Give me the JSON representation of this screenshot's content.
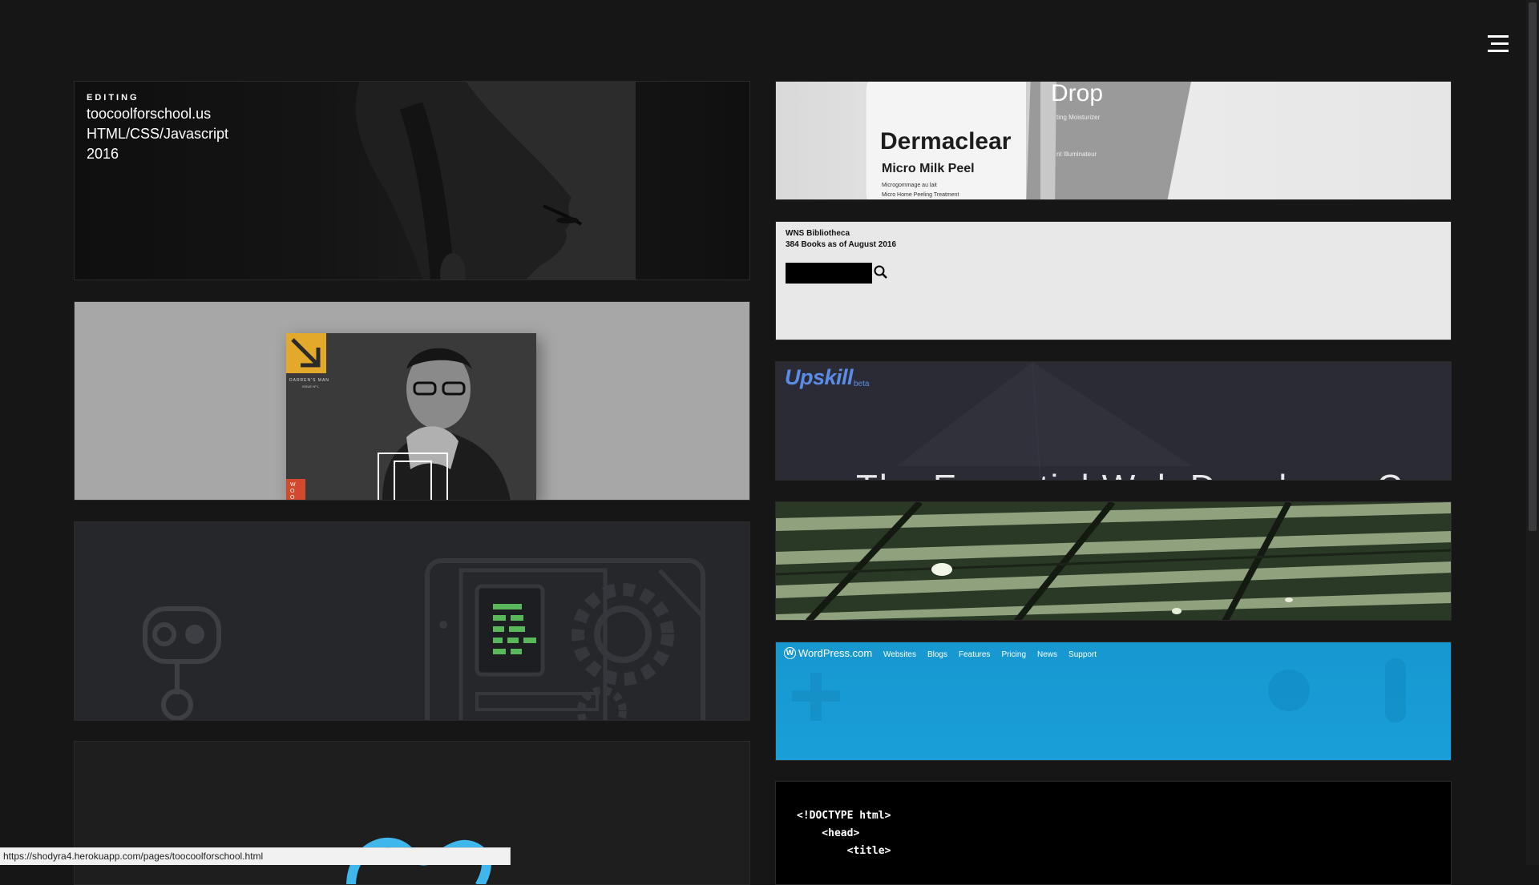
{
  "header": {
    "menu_icon": "hamburger-icon"
  },
  "portfolio": {
    "featured": {
      "category": "EDITING",
      "site": "toocoolforschool.us",
      "tech": "HTML/CSS/Javascript",
      "year": "2016"
    },
    "dermaclear": {
      "brand": "Dermaclear",
      "product": "Micro Milk Peel",
      "fine1": "Microgommage au lait",
      "fine2": "Micro Home Peeling Treatment",
      "brand2": "Drop",
      "sub1": "ting Moisturizer",
      "sub2": "nt Illuminateur"
    },
    "wns": {
      "title": "WNS Bibliotheca",
      "subtitle": "384 Books as of August 2016",
      "search_placeholder": ""
    },
    "magazine": {
      "masthead": "DARREN'S MAN",
      "issue": "ISSUE Nº 1",
      "spine": "WOO"
    },
    "upskill": {
      "logo": "Upskill",
      "badge": "beta",
      "headline": "The Essential Web Developer Course"
    },
    "wordpress": {
      "logo": "WordPress.com",
      "nav": [
        "Websites",
        "Blogs",
        "Features",
        "Pricing",
        "News",
        "Support"
      ]
    },
    "code_tile": {
      "line1": "<!DOCTYPE html>",
      "line2": "    <head>",
      "line3": "        <title>"
    }
  },
  "status_bar": {
    "url": "https://shodyra4.herokuapp.com/pages/toocoolforschool.html"
  },
  "colors": {
    "background": "#161617",
    "upskill_blue": "#5b8de8",
    "wordpress_blue": "#1797d0"
  }
}
